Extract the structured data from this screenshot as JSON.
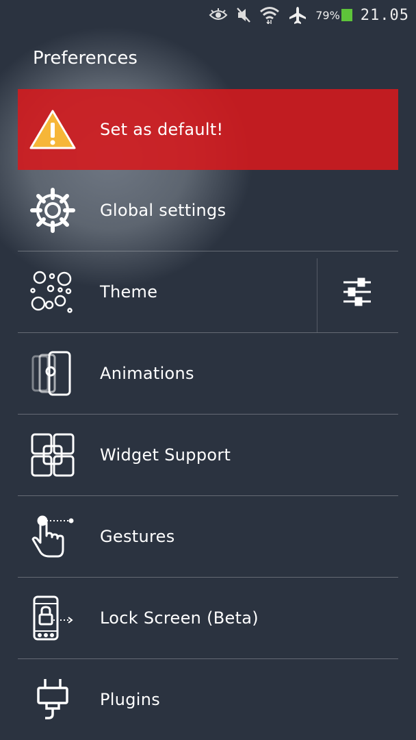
{
  "status_bar": {
    "battery_percent": "79%",
    "time": "21.05",
    "icons": [
      "eye-icon",
      "mute-icon",
      "wifi-icon",
      "airplane-icon",
      "battery-icon"
    ],
    "battery_color": "#5ec43a"
  },
  "header": {
    "title": "Preferences"
  },
  "menu": {
    "items": [
      {
        "label": "Set as default!",
        "icon": "warning-icon"
      },
      {
        "label": "Global settings",
        "icon": "gear-icon"
      },
      {
        "label": "Theme",
        "icon": "theme-bubbles-icon"
      },
      {
        "label": "Animations",
        "icon": "animations-icon"
      },
      {
        "label": "Widget Support",
        "icon": "widget-grid-icon"
      },
      {
        "label": "Gestures",
        "icon": "gesture-hand-icon"
      },
      {
        "label": "Lock Screen (Beta)",
        "icon": "lock-screen-icon"
      },
      {
        "label": "Plugins",
        "icon": "plug-icon"
      }
    ],
    "warning_color": "#d6191c"
  }
}
